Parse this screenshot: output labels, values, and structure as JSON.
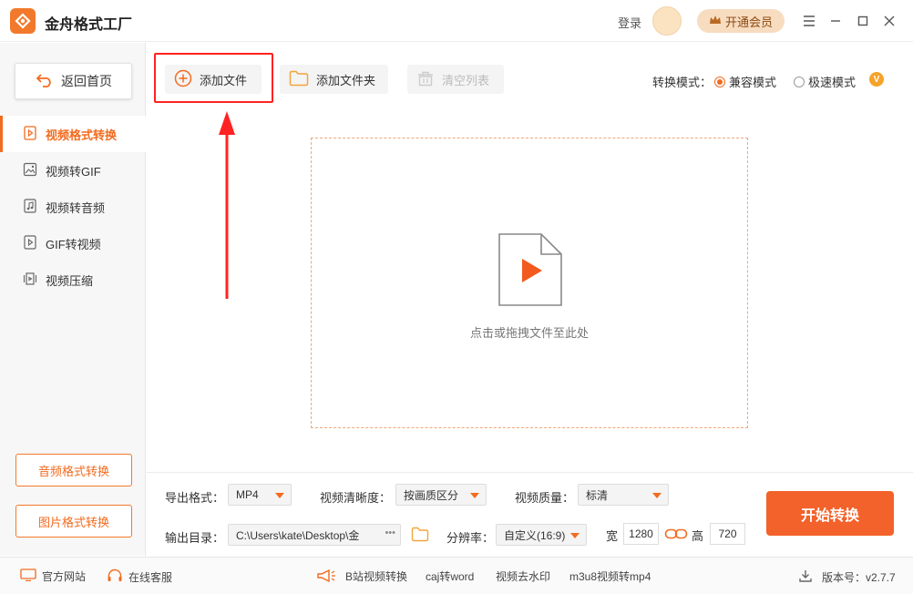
{
  "app": {
    "title": "金舟格式工厂"
  },
  "header": {
    "login": "登录",
    "vip_label": "开通会员"
  },
  "sidebar": {
    "home_label": "返回首页",
    "items": [
      {
        "label": "视频格式转换",
        "active": true
      },
      {
        "label": "视频转GIF"
      },
      {
        "label": "视频转音频"
      },
      {
        "label": "GIF转视频"
      },
      {
        "label": "视频压缩"
      }
    ],
    "audio_button": "音频格式转换",
    "image_button": "图片格式转换"
  },
  "toolbar": {
    "add_file": "添加文件",
    "add_folder": "添加文件夹",
    "clear_list": "清空列表",
    "mode_label": "转换模式：",
    "mode_compat": "兼容模式",
    "mode_fast": "极速模式",
    "vip_badge": "V"
  },
  "dropzone": {
    "hint": "点击或拖拽文件至此处"
  },
  "settings": {
    "format_label": "导出格式：",
    "format_value": "MP4",
    "clarity_label": "视频清晰度：",
    "clarity_value": "按画质区分",
    "quality_label": "视频质量：",
    "quality_value": "标清",
    "output_label": "输出目录：",
    "output_value": "C:\\Users\\kate\\Desktop\\金",
    "output_more": "•••",
    "resolution_label": "分辨率：",
    "resolution_value": "自定义(16:9)",
    "width_label": "宽",
    "width_value": "1280",
    "height_label": "高",
    "height_value": "720",
    "start_button": "开始转换"
  },
  "footer": {
    "website": "官方网站",
    "service": "在线客服",
    "links": [
      "B站视频转换",
      "caj转word",
      "视频去水印",
      "m3u8视频转mp4"
    ],
    "version": "版本号：v2.7.7"
  },
  "colors": {
    "accent": "#f26b1f",
    "highlight": "#ff2222"
  }
}
